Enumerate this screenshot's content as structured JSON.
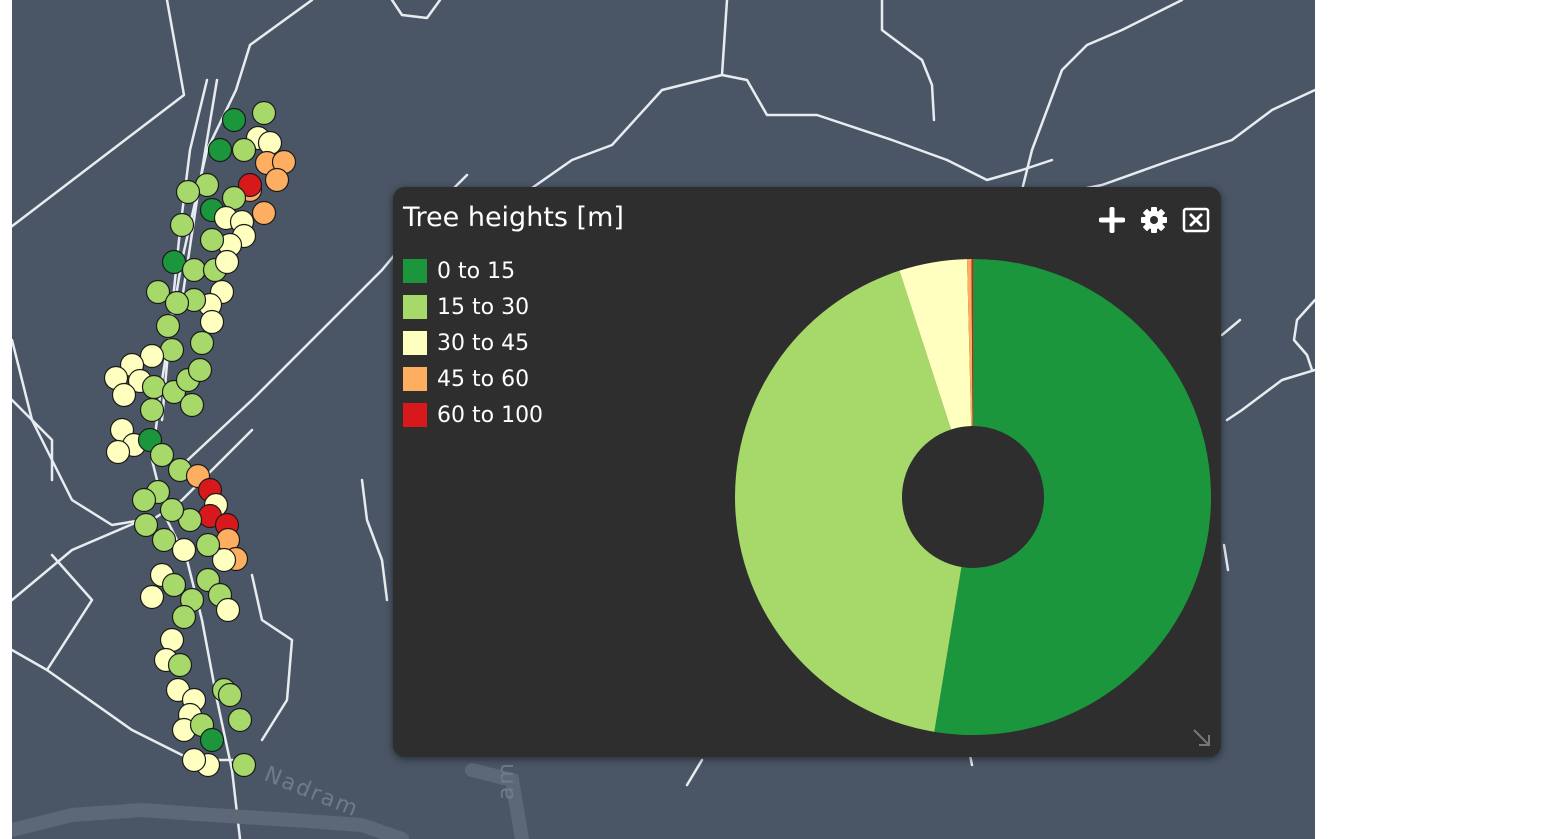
{
  "map": {
    "street_labels": [
      "Nadram",
      "am"
    ],
    "point_colors": {
      "0 to 15": "#1c963c",
      "15 to 30": "#a6d96a",
      "30 to 45": "#ffffbf",
      "45 to 60": "#fdae61",
      "60 to 100": "#d7191c"
    }
  },
  "panel": {
    "title": "Tree heights [m]",
    "tools": [
      {
        "name": "add",
        "icon": "plus-icon"
      },
      {
        "name": "settings",
        "icon": "gear-icon"
      },
      {
        "name": "close",
        "icon": "close-icon"
      }
    ],
    "resize_icon": "resize-handle-icon"
  },
  "chart_data": {
    "type": "pie",
    "donut": true,
    "categories": [
      "0 to 15",
      "15 to 30",
      "30 to 45",
      "45 to 60",
      "60 to 100"
    ],
    "values": [
      52.6,
      42.4,
      4.6,
      0.3,
      0.1
    ],
    "colors": [
      "#1c963c",
      "#a6d96a",
      "#ffffbf",
      "#fdae61",
      "#d7191c"
    ],
    "legend_position": "top-left"
  }
}
